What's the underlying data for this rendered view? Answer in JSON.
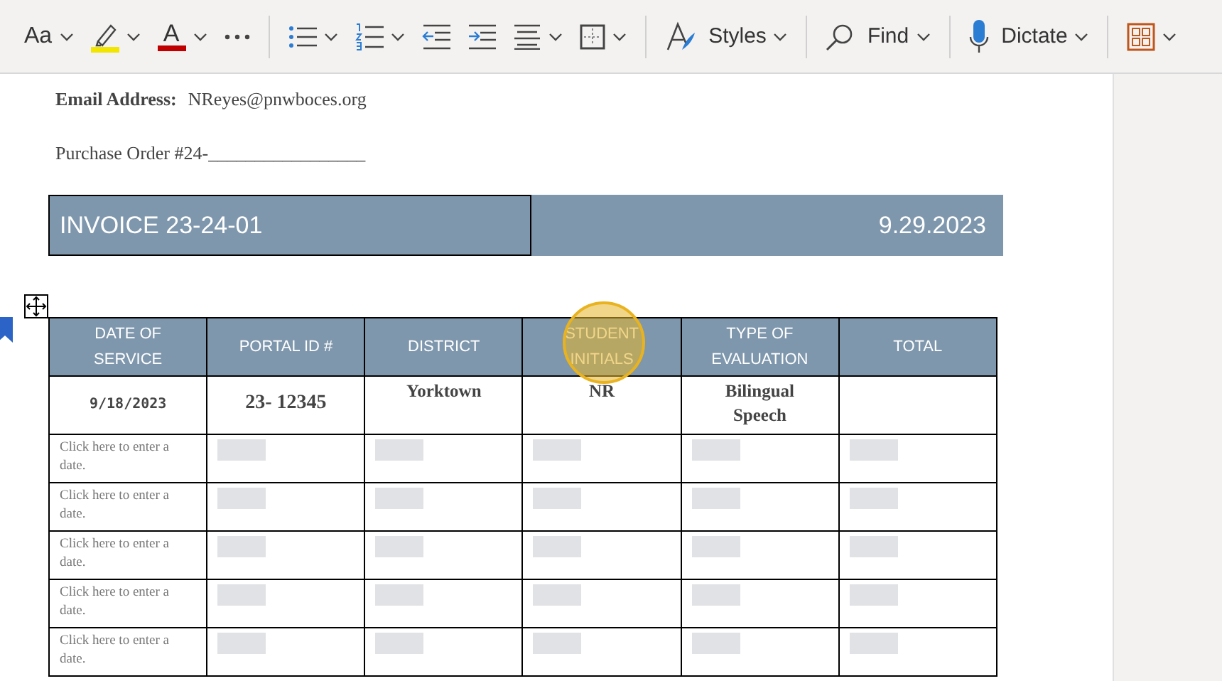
{
  "toolbar": [
    {
      "kind": "text-dropdown",
      "label": "Aa"
    },
    {
      "kind": "highlighter"
    },
    {
      "kind": "font-color",
      "label": "A"
    },
    {
      "kind": "more"
    },
    {
      "kind": "divider"
    },
    {
      "kind": "bullets"
    },
    {
      "kind": "numbering"
    },
    {
      "kind": "outdent"
    },
    {
      "kind": "indent"
    },
    {
      "kind": "align"
    },
    {
      "kind": "borders"
    },
    {
      "kind": "divider"
    },
    {
      "kind": "styles",
      "label": "Styles"
    },
    {
      "kind": "divider"
    },
    {
      "kind": "find",
      "label": "Find"
    },
    {
      "kind": "divider"
    },
    {
      "kind": "dictate",
      "label": "Dictate"
    },
    {
      "kind": "divider"
    },
    {
      "kind": "designer"
    }
  ],
  "document": {
    "email_label": "Email Address:",
    "email_value": "NReyes@pnwboces.org",
    "purchase_order": "Purchase Order #24-_________________",
    "invoice": {
      "title": "INVOICE 23-24-01",
      "date": "9.29.2023"
    },
    "table": {
      "columns": [
        "DATE OF SERVICE",
        "PORTAL ID #",
        "DISTRICT",
        "STUDENT INITIALS",
        "TYPE OF EVALUATION",
        "TOTAL"
      ],
      "rows": [
        {
          "kind": "filled",
          "cells": [
            "9/18/2023",
            "23- 12345",
            "Yorktown",
            "NR",
            "Bilingual Speech",
            ""
          ]
        },
        {
          "kind": "empty",
          "date_placeholder": "Click here to enter a date."
        },
        {
          "kind": "empty",
          "date_placeholder": "Click here to enter a date."
        },
        {
          "kind": "empty",
          "date_placeholder": "Click here to enter a date."
        },
        {
          "kind": "empty",
          "date_placeholder": "Click here to enter a date."
        },
        {
          "kind": "empty",
          "date_placeholder": "Click here to enter a date."
        }
      ]
    }
  }
}
